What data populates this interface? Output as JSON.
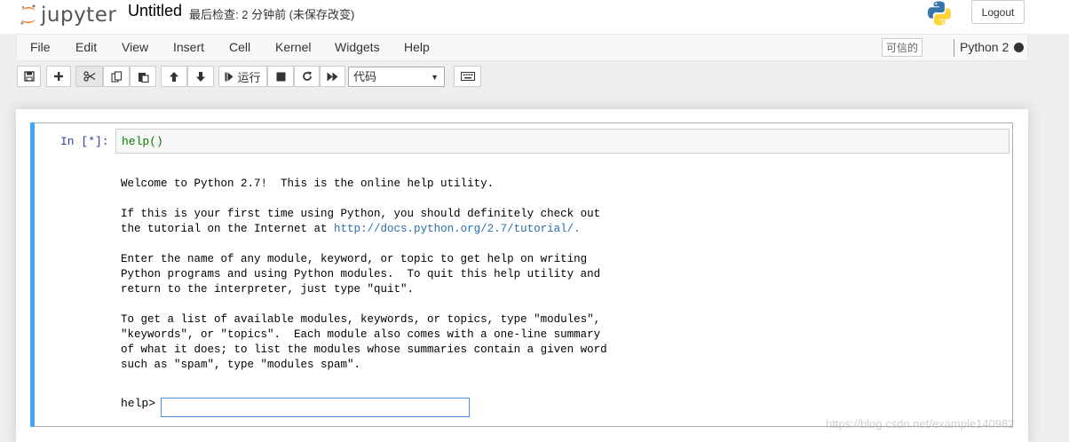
{
  "header": {
    "logo_text": "jupyter",
    "notebook_name": "Untitled",
    "checkpoint_status": "最后检查: 2 分钟前  (未保存改变)",
    "logout_label": "Logout"
  },
  "menubar": {
    "items": [
      "File",
      "Edit",
      "View",
      "Insert",
      "Cell",
      "Kernel",
      "Widgets",
      "Help"
    ],
    "trusted_label": "可信的",
    "kernel_name": "Python 2"
  },
  "toolbar": {
    "run_label": "运行",
    "cell_type": "代码"
  },
  "cell": {
    "prompt": "In  [*]:",
    "code": "help()",
    "output_lines": [
      "Welcome to Python 2.7!  This is the online help utility.",
      "",
      "If this is your first time using Python, you should definitely check out",
      "the tutorial on the Internet at ",
      "",
      "Enter the name of any module, keyword, or topic to get help on writing",
      "Python programs and using Python modules.  To quit this help utility and",
      "return to the interpreter, just type \"quit\".",
      "",
      "To get a list of available modules, keywords, or topics, type \"modules\",",
      "\"keywords\", or \"topics\".  Each module also comes with a one-line summary",
      "of what it does; to list the modules whose summaries contain a given word",
      "such as \"spam\", type \"modules spam\"."
    ],
    "tutorial_link": "http://docs.python.org/2.7/tutorial/.",
    "help_prompt": "help>"
  },
  "watermark": "https://blog.csdn.net/example140982"
}
